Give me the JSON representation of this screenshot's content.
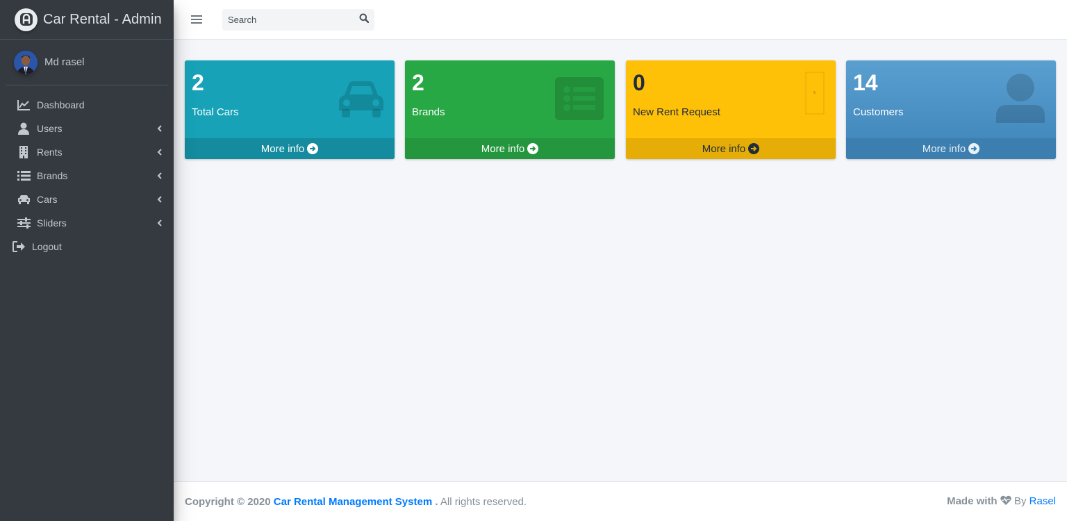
{
  "app": {
    "title": "Car Rental - Admin"
  },
  "user": {
    "name": "Md rasel"
  },
  "sidebar": {
    "items": [
      {
        "label": "Dashboard",
        "icon": "chart-area-icon"
      },
      {
        "label": "Users",
        "icon": "user-icon"
      },
      {
        "label": "Rents",
        "icon": "building-icon"
      },
      {
        "label": "Brands",
        "icon": "list-icon"
      },
      {
        "label": "Cars",
        "icon": "car-icon"
      },
      {
        "label": "Sliders",
        "icon": "sliders-icon"
      },
      {
        "label": "Logout",
        "icon": "sign-out-icon"
      }
    ]
  },
  "search": {
    "placeholder": "Search"
  },
  "cards": [
    {
      "value": "2",
      "label": "Total Cars",
      "link": "More info",
      "icon": "car-icon"
    },
    {
      "value": "2",
      "label": "Brands",
      "link": "More info",
      "icon": "list-icon"
    },
    {
      "value": "0",
      "label": "New Rent Request",
      "link": "More info",
      "icon": "image-icon"
    },
    {
      "value": "14",
      "label": "Customers",
      "link": "More info",
      "icon": "user-icon"
    }
  ],
  "footer": {
    "copyright": "Copyright © 2020",
    "system": "Car Rental Management System",
    "dot": ".",
    "rights": "All rights reserved.",
    "made_with": "Made with",
    "by": "By",
    "author": "Rasel"
  },
  "colors": {
    "sidebar": "#343a40",
    "info": "#17a2b8",
    "success": "#28a745",
    "warning": "#ffc107",
    "primary": "#4a90c4"
  }
}
